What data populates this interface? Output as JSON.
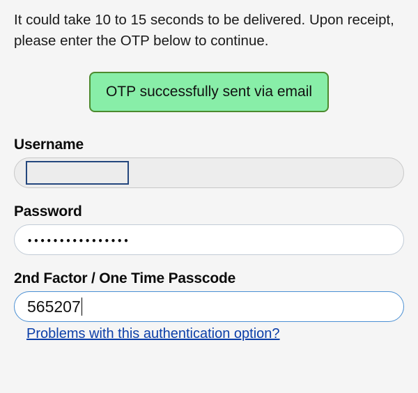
{
  "intro_text": "It could take 10 to 15 seconds to be delivered. Upon receipt, please enter the OTP below to continue.",
  "alert": {
    "message": "OTP successfully sent via email"
  },
  "fields": {
    "username": {
      "label": "Username",
      "value": ""
    },
    "password": {
      "label": "Password",
      "value": "••••••••••••••••"
    },
    "otp": {
      "label": "2nd Factor / One Time Passcode",
      "value": "565207"
    }
  },
  "help_link_text": "Problems with this authentication option?"
}
